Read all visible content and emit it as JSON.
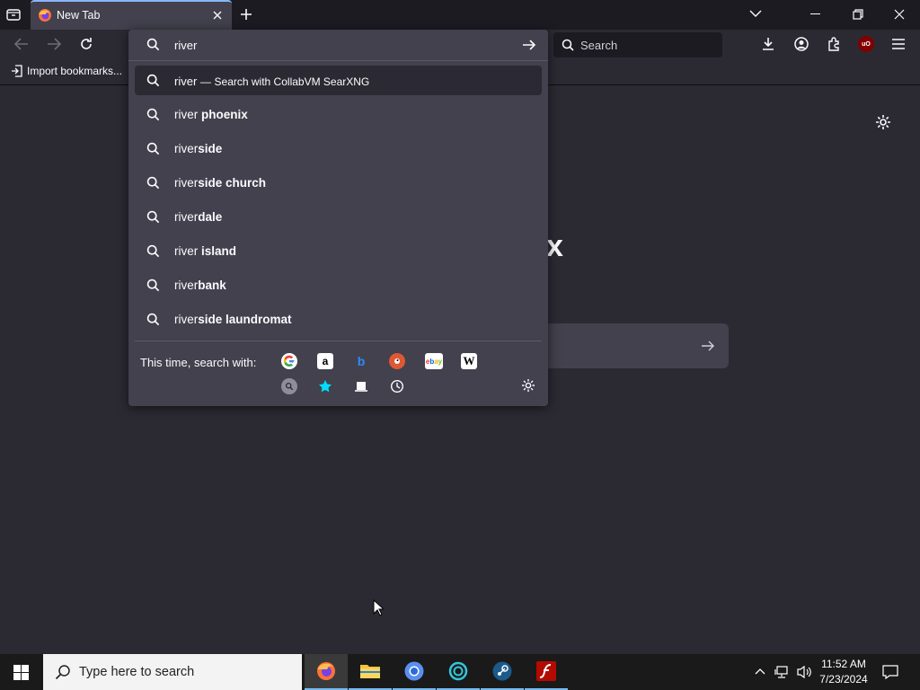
{
  "browser": {
    "tab_title": "New Tab",
    "bookmark_import": "Import bookmarks...",
    "search_placeholder": "Search",
    "url_value": "river"
  },
  "suggestions": [
    {
      "prefix": "river",
      "bold": "",
      "suffix": "Search with CollabVM SearXNG",
      "selected": true
    },
    {
      "prefix": "river ",
      "bold": "phoenix"
    },
    {
      "prefix": "river",
      "bold": "side"
    },
    {
      "prefix": "river",
      "bold": "side church"
    },
    {
      "prefix": "river",
      "bold": "dale"
    },
    {
      "prefix": "river ",
      "bold": "island"
    },
    {
      "prefix": "river",
      "bold": "bank"
    },
    {
      "prefix": "river",
      "bold": "side laundromat"
    }
  ],
  "oneoff": {
    "label": "This time, search with:",
    "engines": [
      "google-icon",
      "amazon-icon",
      "bing-icon",
      "duckduckgo-icon",
      "ebay-icon",
      "wikipedia-icon",
      "searxng-icon",
      "bookmarks-icon",
      "tabs-icon",
      "history-icon"
    ]
  },
  "newtab": {
    "logo_fragment": "x"
  },
  "taskbar": {
    "search_placeholder": "Type here to search",
    "time": "11:52 AM",
    "date": "7/23/2024"
  },
  "colors": {
    "accent": "#8ab4f8",
    "panel": "#42414d",
    "background": "#2b2a33",
    "tabbar": "#1c1b22"
  }
}
